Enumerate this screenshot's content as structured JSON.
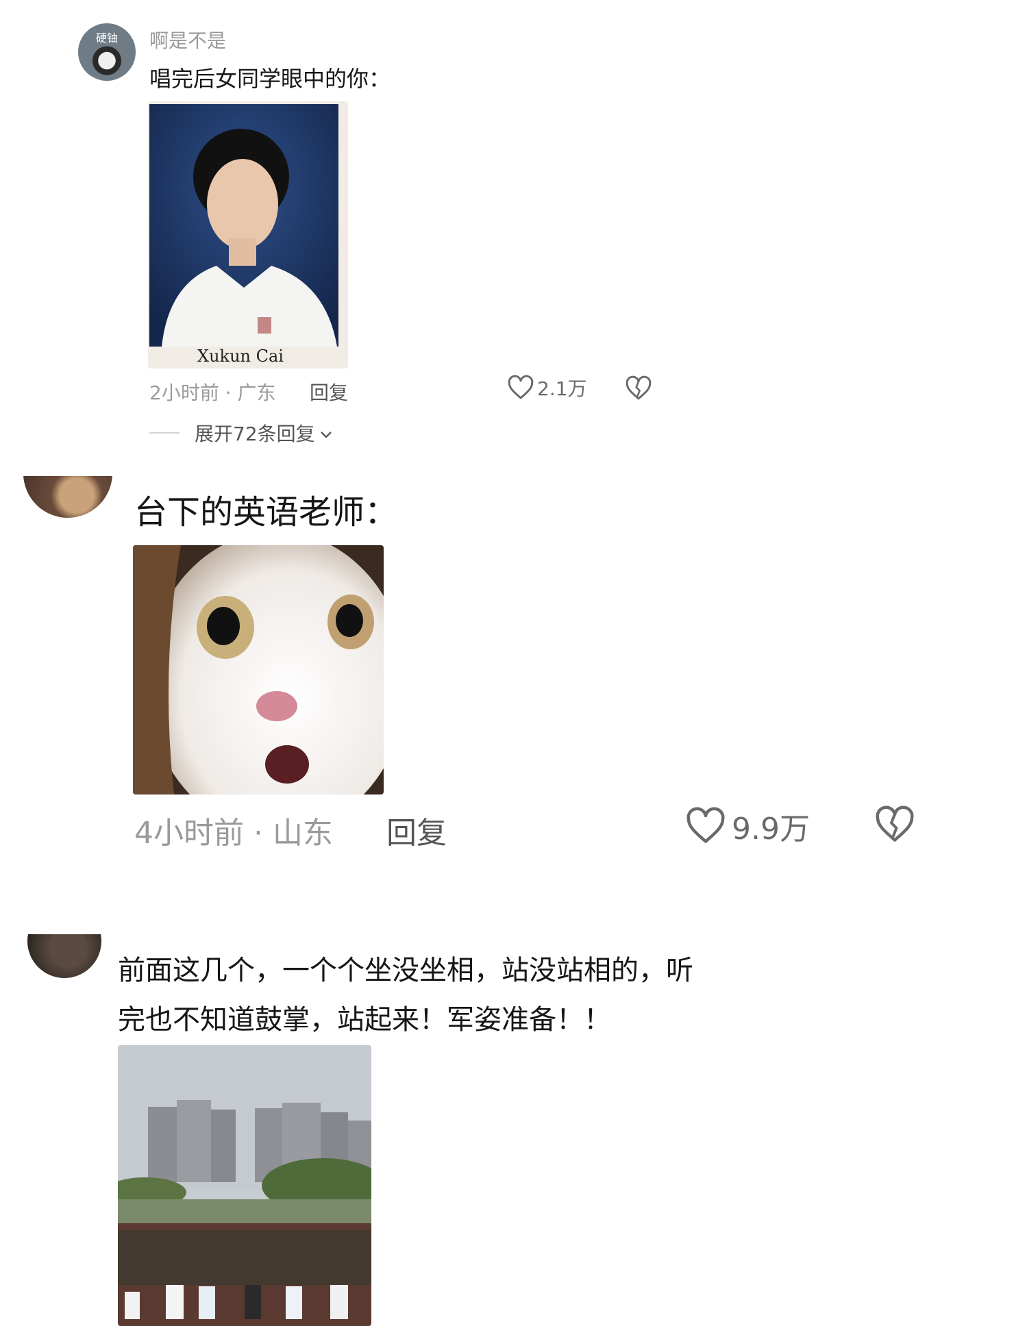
{
  "comments": [
    {
      "username": "啊是不是",
      "avatar_badge": "硬铀",
      "text": "唱完后女同学眼中的你：",
      "image_caption": "Xukun Cai",
      "time_location": "2小时前 · 广东",
      "reply_label": "回复",
      "likes": "2.1万",
      "expand_label": "展开72条回复"
    },
    {
      "text": "台下的英语老师：",
      "time_location": "4小时前 · 山东",
      "reply_label": "回复",
      "likes": "9.9万"
    },
    {
      "text_line1": "前面这几个，一个个坐没坐相，站没站相的，听",
      "text_line2": "完也不知道鼓掌，站起来！军姿准备！！"
    }
  ],
  "colors": {
    "muted": "#9a9a9a",
    "text": "#161616",
    "icon": "#6a6a6a"
  },
  "icons": [
    "heart-outline",
    "broken-heart-outline",
    "chevron-down"
  ]
}
